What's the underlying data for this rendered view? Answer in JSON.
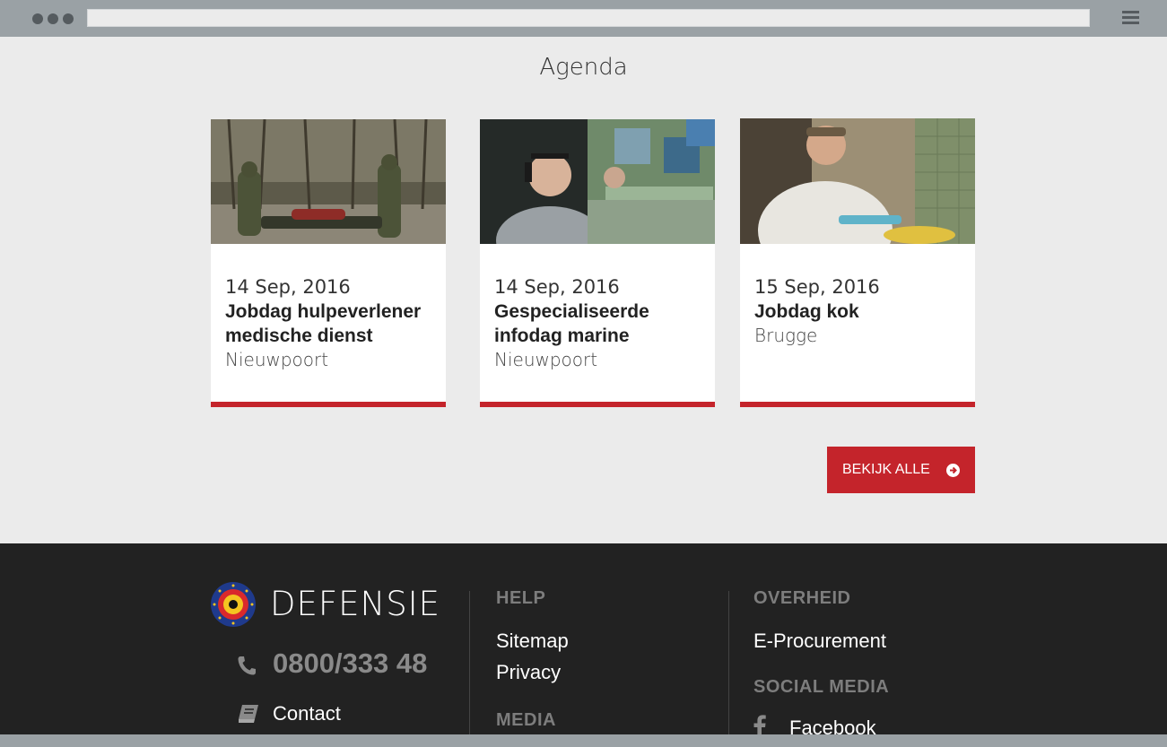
{
  "agenda": {
    "title": "Agenda",
    "items": [
      {
        "date": "14 Sep, 2016",
        "title_line1": "Jobdag hulpeverlener",
        "title_line2": "medische dienst",
        "location": "Nieuwpoort"
      },
      {
        "date": "14 Sep, 2016",
        "title_line1": "Gespecialiseerde",
        "title_line2": "infodag marine",
        "location": "Nieuwpoort"
      },
      {
        "date": "15 Sep, 2016",
        "title_line1": "Jobdag kok",
        "title_line2": "",
        "location": "Brugge"
      }
    ],
    "view_all_label": "BEKIJK ALLE"
  },
  "footer": {
    "brand": "DEFENSIE",
    "phone": "0800/333 48",
    "contact": "Contact",
    "help": {
      "heading": "HELP",
      "links": [
        "Sitemap",
        "Privacy"
      ]
    },
    "media": {
      "heading": "MEDIA"
    },
    "overheid": {
      "heading": "OVERHEID",
      "links": [
        "E-Procurement"
      ]
    },
    "social": {
      "heading": "SOCIAL MEDIA",
      "links": [
        "Facebook"
      ]
    }
  },
  "colors": {
    "accent": "#c4242b",
    "footer_bg": "#222222",
    "page_bg": "#ebebeb",
    "chrome": "#9aa1a5"
  },
  "icons": [
    "menu-icon",
    "arrow-circle-right-icon",
    "phone-icon",
    "book-icon",
    "facebook-icon",
    "defensie-logo"
  ]
}
